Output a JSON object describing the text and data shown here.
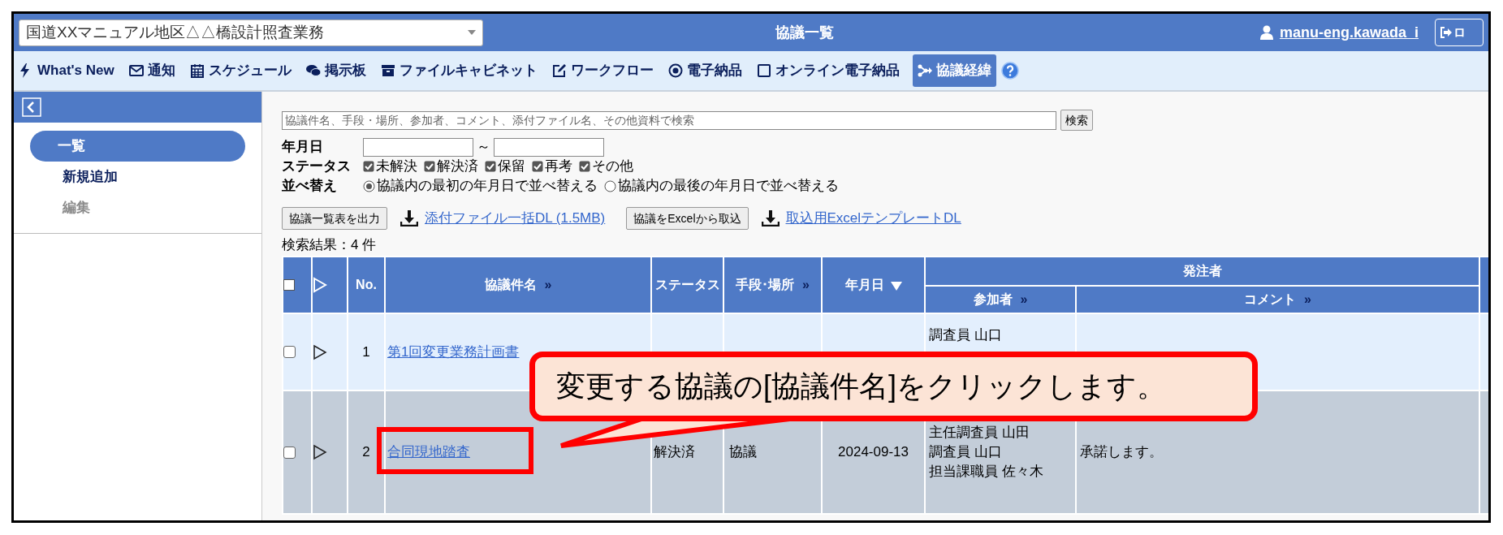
{
  "header": {
    "project_select": {
      "value": "国道XXマニュアル地区△△橋設計照査業務"
    },
    "title": "協議一覧",
    "user": "manu-eng.kawada_i",
    "logout": "ロ"
  },
  "nav": [
    {
      "kind": "bolt",
      "label": "What's New",
      "selected": false
    },
    {
      "kind": "mail",
      "label": "通知",
      "selected": false
    },
    {
      "kind": "calendar",
      "label": "スケジュール",
      "selected": false
    },
    {
      "kind": "chat",
      "label": "掲示板",
      "selected": false
    },
    {
      "kind": "cabinet",
      "label": "ファイルキャビネット",
      "selected": false
    },
    {
      "kind": "edit",
      "label": "ワークフロー",
      "selected": false
    },
    {
      "kind": "radio",
      "label": "電子納品",
      "selected": false
    },
    {
      "kind": "square",
      "label": "オンライン電子納品",
      "selected": false
    },
    {
      "kind": "flow",
      "label": "協議経緯",
      "selected": true
    }
  ],
  "sidebar": {
    "items": [
      {
        "label": "一覧",
        "selected": true,
        "disabled": false
      },
      {
        "label": "新規追加",
        "selected": false,
        "disabled": false
      },
      {
        "label": "編集",
        "selected": false,
        "disabled": true
      }
    ]
  },
  "search": {
    "placeholder": "協議件名、手段・場所、参加者、コメント、添付ファイル名、その他資料で検索",
    "button": "検索"
  },
  "date_filter": {
    "label": "年月日",
    "separator": "～"
  },
  "status_filter": {
    "label": "ステータス",
    "options": [
      {
        "label": "未解決",
        "checked": true
      },
      {
        "label": "解決済",
        "checked": true
      },
      {
        "label": "保留",
        "checked": true
      },
      {
        "label": "再考",
        "checked": true
      },
      {
        "label": "その他",
        "checked": true
      }
    ]
  },
  "sort": {
    "label": "並べ替え",
    "options": [
      {
        "label": "協議内の最初の年月日で並べ替える",
        "selected": true
      },
      {
        "label": "協議内の最後の年月日で並べ替える",
        "selected": false
      }
    ]
  },
  "actions": [
    {
      "kind": "button",
      "label": "協議一覧表を出力"
    },
    {
      "kind": "link",
      "label": "添付ファイル一括DL (1.5MB)"
    },
    {
      "kind": "button",
      "label": "協議をExcelから取込"
    },
    {
      "kind": "link",
      "label": "取込用ExcelテンプレートDL"
    }
  ],
  "result_count": "検索結果：4 件",
  "table": {
    "columns": [
      {
        "kind": "checkbox",
        "checked": false
      },
      {
        "kind": "expand"
      },
      {
        "kind": "text",
        "label": "No."
      },
      {
        "kind": "text",
        "label": "協議件名",
        "suffix": "»"
      },
      {
        "kind": "text",
        "label": "ステータス"
      },
      {
        "kind": "text",
        "label": "手段･場所",
        "suffix": "»"
      },
      {
        "kind": "sort",
        "label": "年月日"
      },
      {
        "kind": "group",
        "label": "発注者",
        "children": [
          {
            "label": "参加者",
            "suffix": "»"
          },
          {
            "label": "コメント",
            "suffix": "»"
          }
        ]
      },
      {
        "kind": "blank"
      }
    ],
    "rows": [
      {
        "checked": false,
        "selected": false,
        "no": "1",
        "title": "第1回変更業務計画書",
        "participants": [
          "調査員 山口"
        ]
      },
      {
        "checked": false,
        "selected": true,
        "no": "2",
        "title": "合同現地踏査",
        "status": "解決済",
        "method": "協議",
        "date": "2024-09-13",
        "participants": [
          "主任調査員 山田",
          "調査員 山口",
          "担当課職員 佐々木"
        ],
        "comment": "承諾します。"
      }
    ]
  },
  "callout": {
    "text": "変更する協議の[協議件名]をクリックします。"
  }
}
